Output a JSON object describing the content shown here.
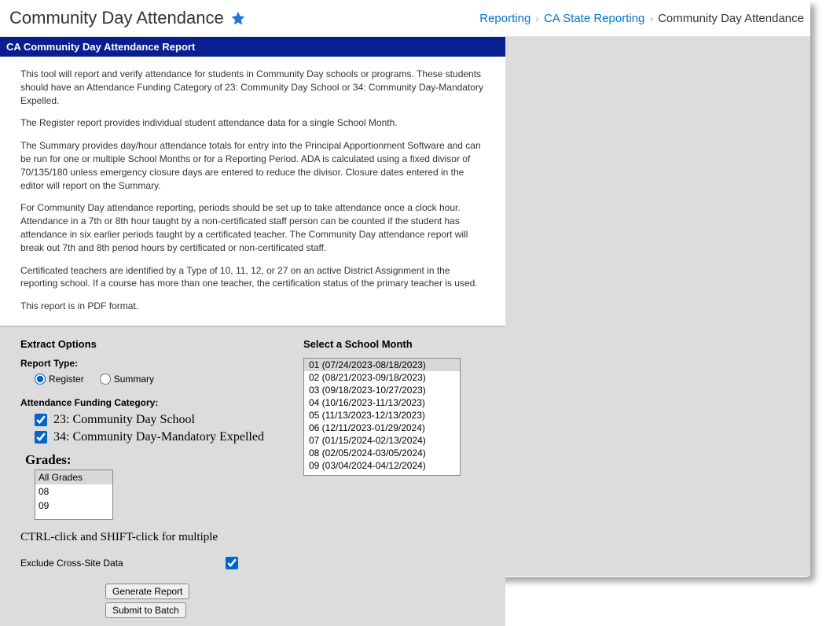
{
  "header": {
    "title": "Community Day Attendance",
    "breadcrumb": {
      "l1": "Reporting",
      "l2": "CA State Reporting",
      "l3": "Community Day Attendance"
    }
  },
  "panel": {
    "title": "CA Community Day Attendance Report",
    "paragraphs": {
      "p1": "This tool will report and verify attendance for students in Community Day schools or programs. These students should have an Attendance Funding Category of 23: Community Day School or 34: Community Day-Mandatory Expelled.",
      "p2": "The Register report provides individual student attendance data for a single School Month.",
      "p3": "The Summary provides day/hour attendance totals for entry into the Principal Apportionment Software and can be run for one or multiple School Months or for a Reporting Period. ADA is calculated using a fixed divisor of 70/135/180 unless emergency closure days are entered to reduce the divisor. Closure dates entered in the editor will report on the Summary.",
      "p4": "For Community Day attendance reporting, periods should be set up to take attendance once a clock hour. Attendance in a 7th or 8th hour taught by a non-certificated staff person can be counted if the student has attendance in six earlier periods taught by a certificated teacher. The Community Day attendance report will break out 7th and 8th period hours by certificated or non-certificated staff.",
      "p5": "Certificated teachers are identified by a Type of 10, 11, 12, or 27 on an active District Assignment in the reporting school. If a course has more than one teacher, the certification status of the primary teacher is used.",
      "p6": "This report is in PDF format."
    }
  },
  "form": {
    "extract_options_label": "Extract Options",
    "report_type_label": "Report Type:",
    "radio_register": "Register",
    "radio_summary": "Summary",
    "afc_label": "Attendance Funding Category:",
    "afc_23": "23: Community Day School",
    "afc_34": "34: Community Day-Mandatory Expelled",
    "grades_label": "Grades:",
    "grades": {
      "g0": "All Grades",
      "g1": "08",
      "g2": "09"
    },
    "ctrl_hint": "CTRL-click and SHIFT-click for multiple",
    "exclude_label": "Exclude Cross-Site Data",
    "generate_btn": "Generate Report",
    "submit_btn": "Submit to Batch",
    "school_month_label": "Select a School Month",
    "months": {
      "m1": "01 (07/24/2023-08/18/2023)",
      "m2": "02 (08/21/2023-09/18/2023)",
      "m3": "03 (09/18/2023-10/27/2023)",
      "m4": "04 (10/16/2023-11/13/2023)",
      "m5": "05 (11/13/2023-12/13/2023)",
      "m6": "06 (12/11/2023-01/29/2024)",
      "m7": "07 (01/15/2024-02/13/2024)",
      "m8": "08 (02/05/2024-03/05/2024)",
      "m9": "09 (03/04/2024-04/12/2024)"
    }
  }
}
